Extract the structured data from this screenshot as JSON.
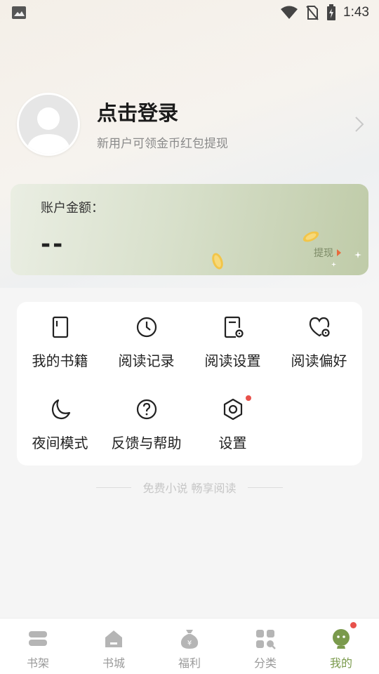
{
  "status_bar": {
    "time": "1:43"
  },
  "profile": {
    "title": "点击登录",
    "subtitle": "新用户可领金币红包提现"
  },
  "balance": {
    "label": "账户金额：",
    "value": "--",
    "withdraw_label": "提现"
  },
  "grid": {
    "items": [
      {
        "label": "我的书籍",
        "icon": "book-icon"
      },
      {
        "label": "阅读记录",
        "icon": "clock-icon"
      },
      {
        "label": "阅读设置",
        "icon": "reading-settings-icon"
      },
      {
        "label": "阅读偏好",
        "icon": "heart-settings-icon"
      },
      {
        "label": "夜间模式",
        "icon": "moon-icon"
      },
      {
        "label": "反馈与帮助",
        "icon": "help-icon"
      },
      {
        "label": "设置",
        "icon": "gear-icon"
      }
    ]
  },
  "slogan": "免费小说 畅享阅读",
  "bottom_nav": {
    "items": [
      {
        "label": "书架",
        "icon": "bookshelf-icon"
      },
      {
        "label": "书城",
        "icon": "bookstore-icon"
      },
      {
        "label": "福利",
        "icon": "money-bag-icon"
      },
      {
        "label": "分类",
        "icon": "category-icon"
      },
      {
        "label": "我的",
        "icon": "profile-face-icon"
      }
    ],
    "active_index": 4
  },
  "colors": {
    "accent_green": "#7a9a4c",
    "red_dot": "#e8514b",
    "card_green": "#bfcba8"
  }
}
